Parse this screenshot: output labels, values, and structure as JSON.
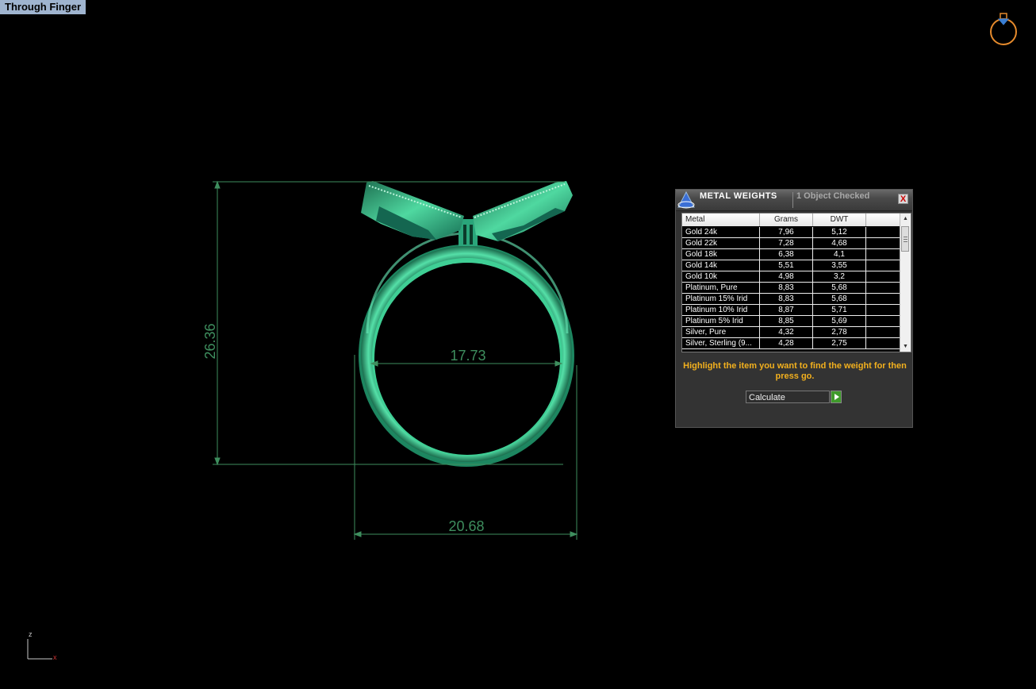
{
  "viewport": {
    "label": "Through Finger"
  },
  "dimensions": {
    "height": "26.36",
    "inner_diameter": "17.73",
    "outer_width": "20.68"
  },
  "axis": {
    "z_label": "z",
    "x_label": "x"
  },
  "metal_panel": {
    "title": "METAL WEIGHTS",
    "status": "1 Object Checked",
    "close_label": "X",
    "columns": [
      "Metal",
      "Grams",
      "DWT"
    ],
    "rows": [
      {
        "metal": "Gold 24k",
        "grams": "7,96",
        "dwt": "5,12"
      },
      {
        "metal": "Gold 22k",
        "grams": "7,28",
        "dwt": "4,68"
      },
      {
        "metal": "Gold 18k",
        "grams": "6,38",
        "dwt": "4,1"
      },
      {
        "metal": "Gold 14k",
        "grams": "5,51",
        "dwt": "3,55"
      },
      {
        "metal": "Gold 10k",
        "grams": "4,98",
        "dwt": "3,2"
      },
      {
        "metal": "Platinum, Pure",
        "grams": "8,83",
        "dwt": "5,68"
      },
      {
        "metal": "Platinum 15% Irid",
        "grams": "8,83",
        "dwt": "5,68"
      },
      {
        "metal": "Platinum 10% Irid",
        "grams": "8,87",
        "dwt": "5,71"
      },
      {
        "metal": "Platinum 5% Irid",
        "grams": "8,85",
        "dwt": "5,69"
      },
      {
        "metal": "Silver, Pure",
        "grams": "4,32",
        "dwt": "2,78"
      },
      {
        "metal": "Silver, Sterling (9...",
        "grams": "4,28",
        "dwt": "2,75"
      }
    ],
    "instruction": "Highlight the item you want to find the weight for then press go.",
    "calculate_value": "Calculate",
    "colors": {
      "accent": "#f2b01e",
      "go": "#3f9a2b"
    }
  },
  "colors": {
    "ring": "#2fbf8a",
    "dimension": "#3e8e5e",
    "background": "#000000"
  }
}
